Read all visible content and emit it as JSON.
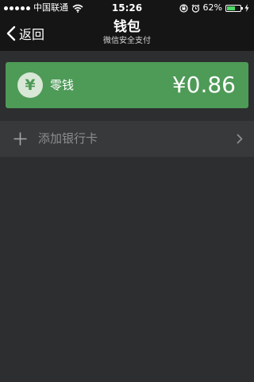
{
  "status_bar": {
    "carrier": "中国联通",
    "time": "15:26",
    "battery_percent": "62%",
    "battery_level": 0.62
  },
  "nav": {
    "back_label": "返回",
    "title": "钱包",
    "subtitle": "微信安全支付"
  },
  "wallet": {
    "icon_symbol": "¥",
    "label": "零钱",
    "amount": "¥0.86"
  },
  "add_card": {
    "label": "添加银行卡"
  },
  "colors": {
    "accent_green": "#4e9a57",
    "background": "#2d2e2f",
    "bar_background": "#151516",
    "row_background": "#37393a"
  }
}
